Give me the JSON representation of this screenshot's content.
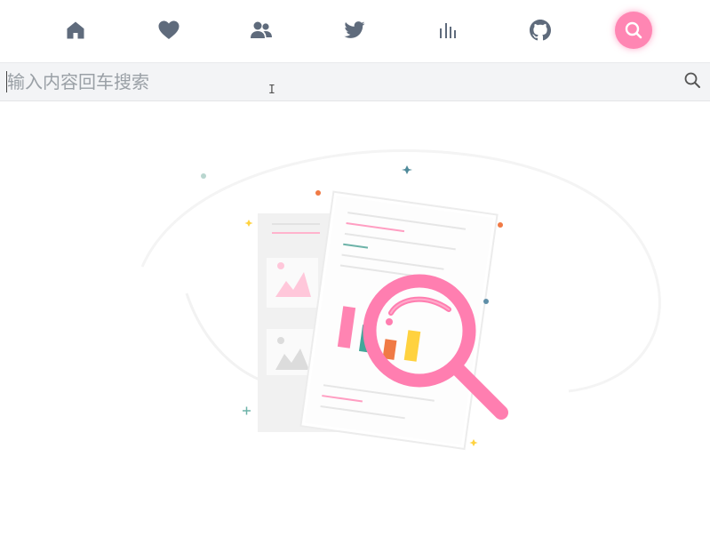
{
  "nav": {
    "items": [
      {
        "icon": "home-icon",
        "active": false
      },
      {
        "icon": "heart-icon",
        "active": false
      },
      {
        "icon": "users-icon",
        "active": false
      },
      {
        "icon": "twitter-icon",
        "active": false
      },
      {
        "icon": "bar-chart-icon",
        "active": false
      },
      {
        "icon": "github-icon",
        "active": false
      },
      {
        "icon": "search-icon",
        "active": true
      }
    ],
    "icon_color": "#5f6b7c",
    "active_color": "#ff86b3"
  },
  "search": {
    "placeholder": "输入内容回车搜索",
    "value": ""
  },
  "empty_state": {
    "illustration": "document-magnifier-illustration",
    "accent": "#ff7eb0"
  }
}
